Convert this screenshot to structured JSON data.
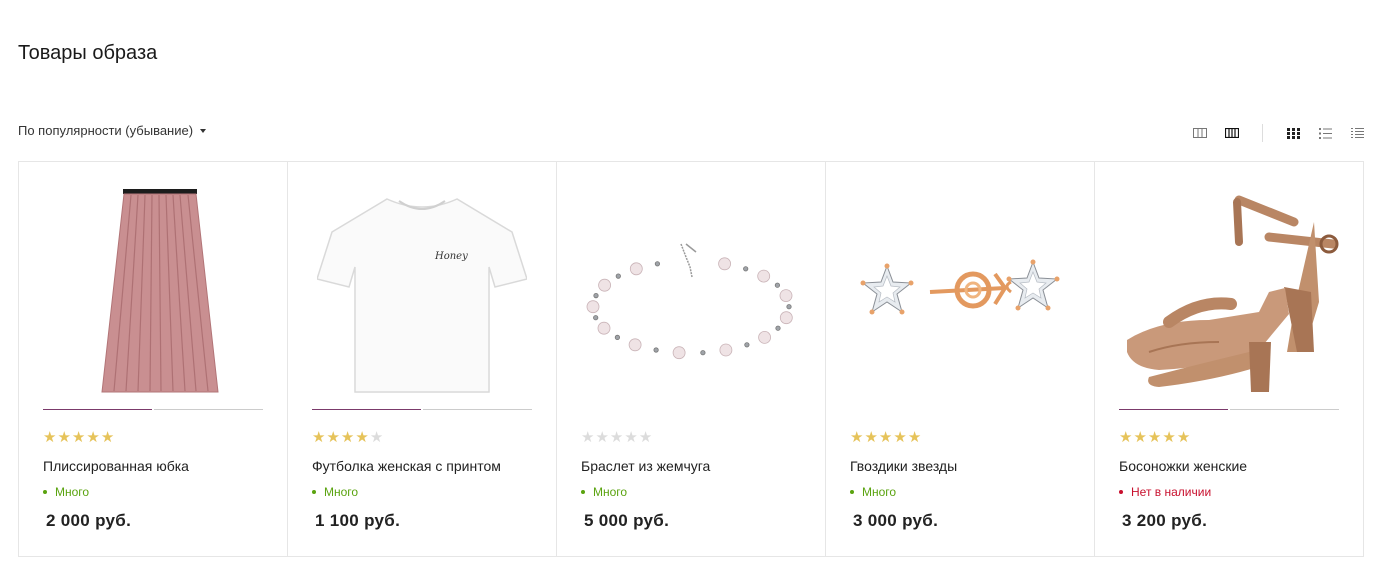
{
  "page": {
    "title": "Товары образа"
  },
  "sort": {
    "label": "По популярности (убывание)"
  },
  "view": {
    "buttons": [
      {
        "icon": "grid-3-cols-icon",
        "active": false
      },
      {
        "icon": "grid-4-cols-icon",
        "active": true
      },
      {
        "icon": "tiles-icon",
        "active": true
      },
      {
        "icon": "list-icon",
        "active": false
      },
      {
        "icon": "compact-list-icon",
        "active": false
      }
    ]
  },
  "colors": {
    "accent": "#7b3a6b",
    "in_stock": "#5aa30f",
    "out_of_stock": "#c8102e",
    "star": "#e6c35a"
  },
  "products": [
    {
      "name": "Плиссированная юбка",
      "rating": 5,
      "stock": "Много",
      "in_stock": true,
      "price": "2 000 руб.",
      "image": "skirt",
      "slides": 2,
      "active_slide": 0
    },
    {
      "name": "Футболка женская с принтом",
      "rating": 4,
      "stock": "Много",
      "in_stock": true,
      "price": "1 100 руб.",
      "image": "tshirt",
      "slides": 2,
      "active_slide": 0
    },
    {
      "name": "Браслет из жемчуга",
      "rating": 0,
      "stock": "Много",
      "in_stock": true,
      "price": "5 000 руб.",
      "image": "bracelet",
      "slides": 0,
      "active_slide": 0
    },
    {
      "name": "Гвоздики звезды",
      "rating": 5,
      "stock": "Много",
      "in_stock": true,
      "price": "3 000 руб.",
      "image": "earrings",
      "slides": 0,
      "active_slide": 0
    },
    {
      "name": "Босоножки женские",
      "rating": 5,
      "stock": "Нет в наличии",
      "in_stock": false,
      "price": "3 200 руб.",
      "image": "sandals",
      "slides": 2,
      "active_slide": 0
    }
  ]
}
